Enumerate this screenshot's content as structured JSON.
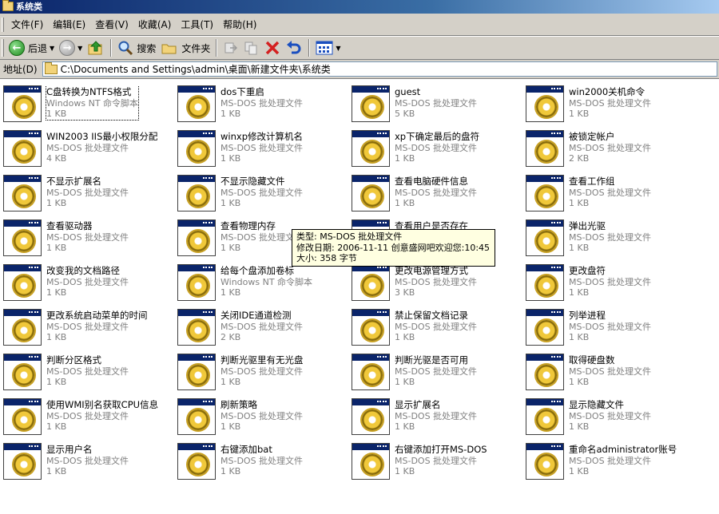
{
  "window": {
    "title": "系统类"
  },
  "menu": [
    "文件(F)",
    "编辑(E)",
    "查看(V)",
    "收藏(A)",
    "工具(T)",
    "帮助(H)"
  ],
  "toolbar": {
    "back": "后退",
    "search": "搜索",
    "folders": "文件夹"
  },
  "address": {
    "label": "地址(D)",
    "path": "C:\\Documents and Settings\\admin\\桌面\\新建文件夹\\系统类"
  },
  "files": [
    {
      "name": "C盘转换为NTFS格式",
      "type": "Windows NT 命令脚本",
      "size": "1 KB"
    },
    {
      "name": "dos下重启",
      "type": "MS-DOS 批处理文件",
      "size": "1 KB"
    },
    {
      "name": "guest",
      "type": "MS-DOS 批处理文件",
      "size": "5 KB"
    },
    {
      "name": "win2000关机命令",
      "type": "MS-DOS 批处理文件",
      "size": "1 KB"
    },
    {
      "name": "WIN2003 IIS最小权限分配",
      "type": "MS-DOS 批处理文件",
      "size": "4 KB"
    },
    {
      "name": "winxp修改计算机名",
      "type": "MS-DOS 批处理文件",
      "size": "1 KB"
    },
    {
      "name": "xp下确定最后的盘符",
      "type": "MS-DOS 批处理文件",
      "size": "1 KB"
    },
    {
      "name": "被锁定帐户",
      "type": "MS-DOS 批处理文件",
      "size": "2 KB"
    },
    {
      "name": "不显示扩展名",
      "type": "MS-DOS 批处理文件",
      "size": "1 KB"
    },
    {
      "name": "不显示隐藏文件",
      "type": "MS-DOS 批处理文件",
      "size": "1 KB"
    },
    {
      "name": "查看电脑硬件信息",
      "type": "MS-DOS 批处理文件",
      "size": "1 KB"
    },
    {
      "name": "查看工作组",
      "type": "MS-DOS 批处理文件",
      "size": "1 KB"
    },
    {
      "name": "查看驱动器",
      "type": "MS-DOS 批处理文件",
      "size": "1 KB"
    },
    {
      "name": "查看物理内存",
      "type": "MS-DOS 批处理文件",
      "size": "1 KB"
    },
    {
      "name": "查看用户是否存在",
      "type": "MS-DOS 批处理文件",
      "size": "1 KB"
    },
    {
      "name": "弹出光驱",
      "type": "MS-DOS 批处理文件",
      "size": "1 KB"
    },
    {
      "name": "改变我的文档路径",
      "type": "MS-DOS 批处理文件",
      "size": "1 KB"
    },
    {
      "name": "给每个盘添加卷标",
      "type": "Windows NT 命令脚本",
      "size": "1 KB"
    },
    {
      "name": "更改电源管理方式",
      "type": "MS-DOS 批处理文件",
      "size": "3 KB"
    },
    {
      "name": "更改盘符",
      "type": "MS-DOS 批处理文件",
      "size": "1 KB"
    },
    {
      "name": "更改系统启动菜单的时间",
      "type": "MS-DOS 批处理文件",
      "size": "1 KB"
    },
    {
      "name": "关闭IDE通道检测",
      "type": "MS-DOS 批处理文件",
      "size": "2 KB"
    },
    {
      "name": "禁止保留文档记录",
      "type": "MS-DOS 批处理文件",
      "size": "1 KB"
    },
    {
      "name": "列举进程",
      "type": "MS-DOS 批处理文件",
      "size": "1 KB"
    },
    {
      "name": "判断分区格式",
      "type": "MS-DOS 批处理文件",
      "size": "1 KB"
    },
    {
      "name": "判断光驱里有无光盘",
      "type": "MS-DOS 批处理文件",
      "size": "1 KB"
    },
    {
      "name": "判断光驱是否可用",
      "type": "MS-DOS 批处理文件",
      "size": "1 KB"
    },
    {
      "name": "取得硬盘数",
      "type": "MS-DOS 批处理文件",
      "size": "1 KB"
    },
    {
      "name": "使用WMI别名获取CPU信息",
      "type": "MS-DOS 批处理文件",
      "size": "1 KB"
    },
    {
      "name": "刷新策略",
      "type": "MS-DOS 批处理文件",
      "size": "1 KB"
    },
    {
      "name": "显示扩展名",
      "type": "MS-DOS 批处理文件",
      "size": "1 KB"
    },
    {
      "name": "显示隐藏文件",
      "type": "MS-DOS 批处理文件",
      "size": "1 KB"
    },
    {
      "name": "显示用户名",
      "type": "MS-DOS 批处理文件",
      "size": "1 KB"
    },
    {
      "name": "右键添加bat",
      "type": "MS-DOS 批处理文件",
      "size": "1 KB"
    },
    {
      "name": "右键添加打开MS-DOS",
      "type": "MS-DOS 批处理文件",
      "size": "1 KB"
    },
    {
      "name": "重命名administrator账号",
      "type": "MS-DOS 批处理文件",
      "size": "1 KB"
    }
  ],
  "tooltip": {
    "line1": "类型: MS-DOS 批处理文件",
    "line2": "修改日期: 2006-11-11 创意盛网吧欢迎您:10:45",
    "line3": "大小: 358 字节"
  }
}
